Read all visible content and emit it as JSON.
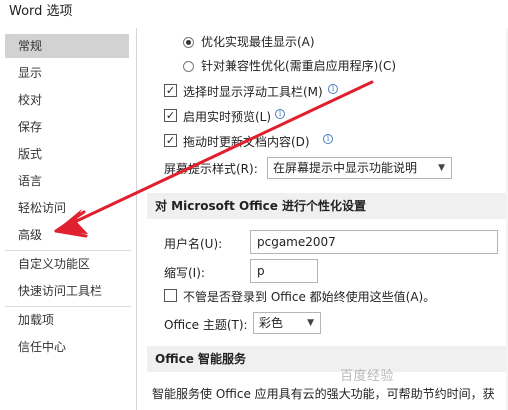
{
  "window": {
    "title": "Word 选项"
  },
  "sidebar": {
    "items": [
      {
        "label": "常规",
        "selected": true
      },
      {
        "label": "显示"
      },
      {
        "label": "校对"
      },
      {
        "label": "保存"
      },
      {
        "label": "版式"
      },
      {
        "label": "语言"
      },
      {
        "label": "轻松访问"
      },
      {
        "label": "高级"
      },
      {
        "label": "自定义功能区"
      },
      {
        "label": "快速访问工具栏"
      },
      {
        "label": "加载项"
      },
      {
        "label": "信任中心"
      }
    ]
  },
  "ui_options": {
    "radio_optimize_display": "优化实现最佳显示(A)",
    "radio_compatibility": "针对兼容性优化(需重启应用程序)(C)",
    "check_mini_toolbar": "选择时显示浮动工具栏(M)",
    "check_live_preview": "启用实时预览(L)",
    "check_update_drag": "拖动时更新文档内容(D)",
    "screentip_label": "屏幕提示样式(R):",
    "screentip_value": "在屏幕提示中显示功能说明"
  },
  "personalize": {
    "heading": "对 Microsoft Office 进行个性化设置",
    "username_label": "用户名(U):",
    "username_value": "pcgame2007",
    "initials_label": "缩写(I):",
    "initials_value": "p",
    "always_use_label": "不管是否登录到 Office 都始终使用这些值(A)。",
    "theme_label": "Office 主题(T):",
    "theme_value": "彩色"
  },
  "intelligent": {
    "heading": "Office 智能服务",
    "description": "智能服务使 Office 应用具有云的强大功能，可帮助节约时间，获"
  },
  "watermark": "百度经验",
  "accent": {
    "arrow": "#e0202e",
    "info_icon": "#4a7cc1"
  }
}
